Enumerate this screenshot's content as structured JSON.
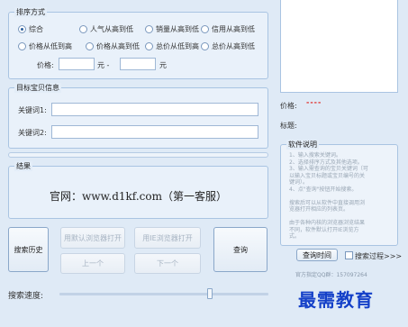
{
  "sort_group": {
    "title": "排序方式",
    "options": [
      "综合",
      "人气从高到低",
      "销量从高到低",
      "信用从高到低",
      "价格从低到高",
      "价格从高到低",
      "总价从低到高",
      "总价从高到低"
    ],
    "selected": "综合",
    "price_label": "价格:",
    "price_min": "",
    "price_sep": "元 -",
    "price_max": "",
    "price_unit": "元"
  },
  "target_group": {
    "title": "目标宝贝信息",
    "keyword1_label": "关键词1:",
    "keyword1_value": "",
    "keyword2_label": "关键词2:",
    "keyword2_value": ""
  },
  "result_group": {
    "title": "结果",
    "text": "官网：www.d1kf.com（第一客服）"
  },
  "buttons": {
    "search_history": "搜索历史",
    "open_default_browser": "用默认浏览器打开",
    "open_ie": "用IE浏览器打开",
    "query": "查询",
    "prev": "上一个",
    "next": "下一个",
    "query_time": "查询时间",
    "search_process": "搜索过程>>>"
  },
  "speed": {
    "label": "搜索速度:",
    "level": 0.72
  },
  "right_panel": {
    "price_label": "价格:",
    "price_value": "----",
    "title_label": "标题:",
    "title_value": ""
  },
  "instructions": {
    "title": "软件说明",
    "lines": [
      "1、输入搜索关键词。",
      "2、选择排序方式及其他选项。",
      "3、输入需查询的宝贝关键词（可",
      "以输入宝贝标题或宝贝编号的关",
      "键词）。",
      "4、点\"查询\"按钮开始搜索。",
      "",
      "搜索后可以从软件中直接调用浏",
      "览器打开相应的列表页。",
      "",
      "由于各种内核的浏览器浏览结果",
      "不同，软件默认打开IE浏览方",
      "式。"
    ]
  },
  "footer": {
    "official_qq": "官方指定QQ群：157097264"
  },
  "watermark": "最需教育",
  "colors": {
    "background": "#dfeaf6",
    "accent": "#2a5f9e",
    "price": "#e0201a",
    "watermark": "#1440c8"
  }
}
